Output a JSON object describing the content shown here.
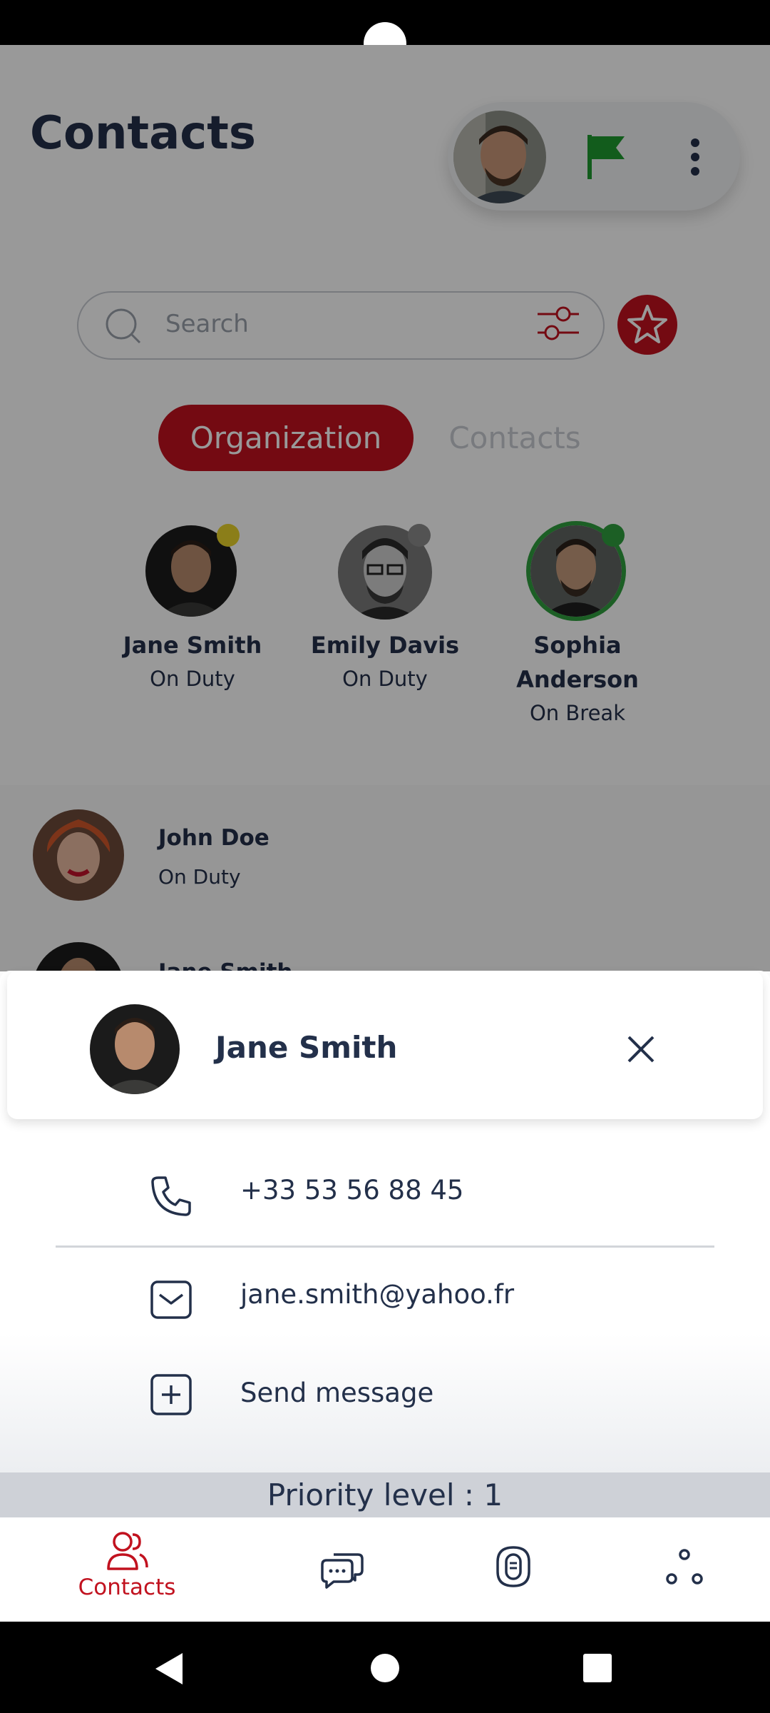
{
  "header": {
    "title": "Contacts"
  },
  "search": {
    "placeholder": "Search"
  },
  "tabs": [
    {
      "label": "Organization",
      "active": true
    },
    {
      "label": "Contacts",
      "active": false
    }
  ],
  "organization": [
    {
      "name": "Jane Smith",
      "status": "On Duty",
      "status_color": "#e8d32b"
    },
    {
      "name": "Emily Davis",
      "status": "On Duty",
      "status_color": "#8a8a8a"
    },
    {
      "name_line1": "Sophia",
      "name_line2": "Anderson",
      "status": "On Break",
      "status_color": "#2f9e3f"
    }
  ],
  "contact_list": [
    {
      "name": "John Doe",
      "status": "On Duty"
    },
    {
      "name": "Jane Smith"
    }
  ],
  "sheet": {
    "name": "Jane Smith",
    "phone": "+33 53 56 88 45",
    "email": "jane.smith@yahoo.fr",
    "send_message_label": "Send message",
    "priority": "Priority level : 1"
  },
  "bottom_nav": {
    "contacts_label": "Contacts",
    "active": "contacts"
  },
  "colors": {
    "accent": "#c1121f",
    "text": "#23304a",
    "flag": "#1f9a2f"
  },
  "icons": [
    "search-icon",
    "filter-icon",
    "star-icon",
    "flag-icon",
    "more-icon",
    "close-icon",
    "phone-icon",
    "mail-icon",
    "add-message-icon",
    "contacts-icon",
    "chat-icon",
    "device-icon",
    "network-icon"
  ]
}
